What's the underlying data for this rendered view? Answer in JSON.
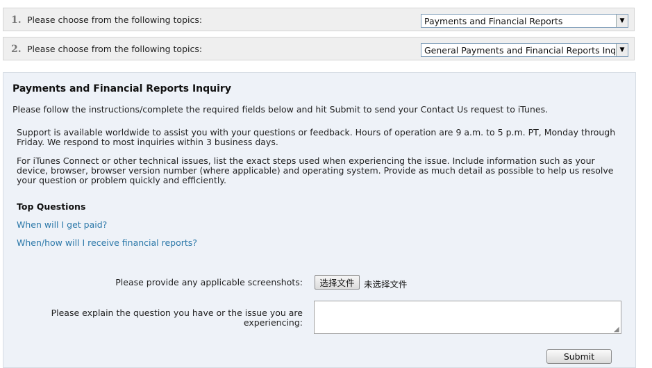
{
  "topics": [
    {
      "number": "1.",
      "label": "Please choose from the following topics:",
      "selected": "Payments and Financial Reports"
    },
    {
      "number": "2.",
      "label": "Please choose from the following topics:",
      "selected": "General Payments and Financial Reports Inquiry"
    }
  ],
  "panel": {
    "heading": "Payments and Financial Reports Inquiry",
    "instructions": "Please follow the instructions/complete the required fields below and hit Submit to send your Contact Us request to iTunes.",
    "paragraphs": [
      "Support is available worldwide to assist you with your questions or feedback. Hours of operation are 9 a.m. to 5 p.m. PT, Monday through Friday. We respond to most inquiries within 3 business days.",
      "For iTunes Connect or other technical issues, list the exact steps used when experiencing the issue. Include information such as your device, browser, browser version number (where applicable) and operating system. Provide as much detail as possible to help us resolve your question or problem quickly and efficiently."
    ],
    "top_questions_title": "Top Questions",
    "top_questions": [
      "When will I get paid?",
      "When/how will I receive financial reports?"
    ]
  },
  "form": {
    "screenshots_label": "Please provide any applicable screenshots:",
    "file_button": "选择文件",
    "file_status": "未选择文件",
    "explain_label": "Please explain the question you have or the issue you are experiencing:",
    "explain_value": "",
    "submit_label": "Submit"
  },
  "icons": {
    "dropdown_arrow": "chevron-down-icon",
    "resize_grip": "resize-grip-icon"
  },
  "colors": {
    "link": "#2a77a8",
    "panel_bg": "#eef2f8",
    "topic_bar_bg": "#efefef"
  }
}
